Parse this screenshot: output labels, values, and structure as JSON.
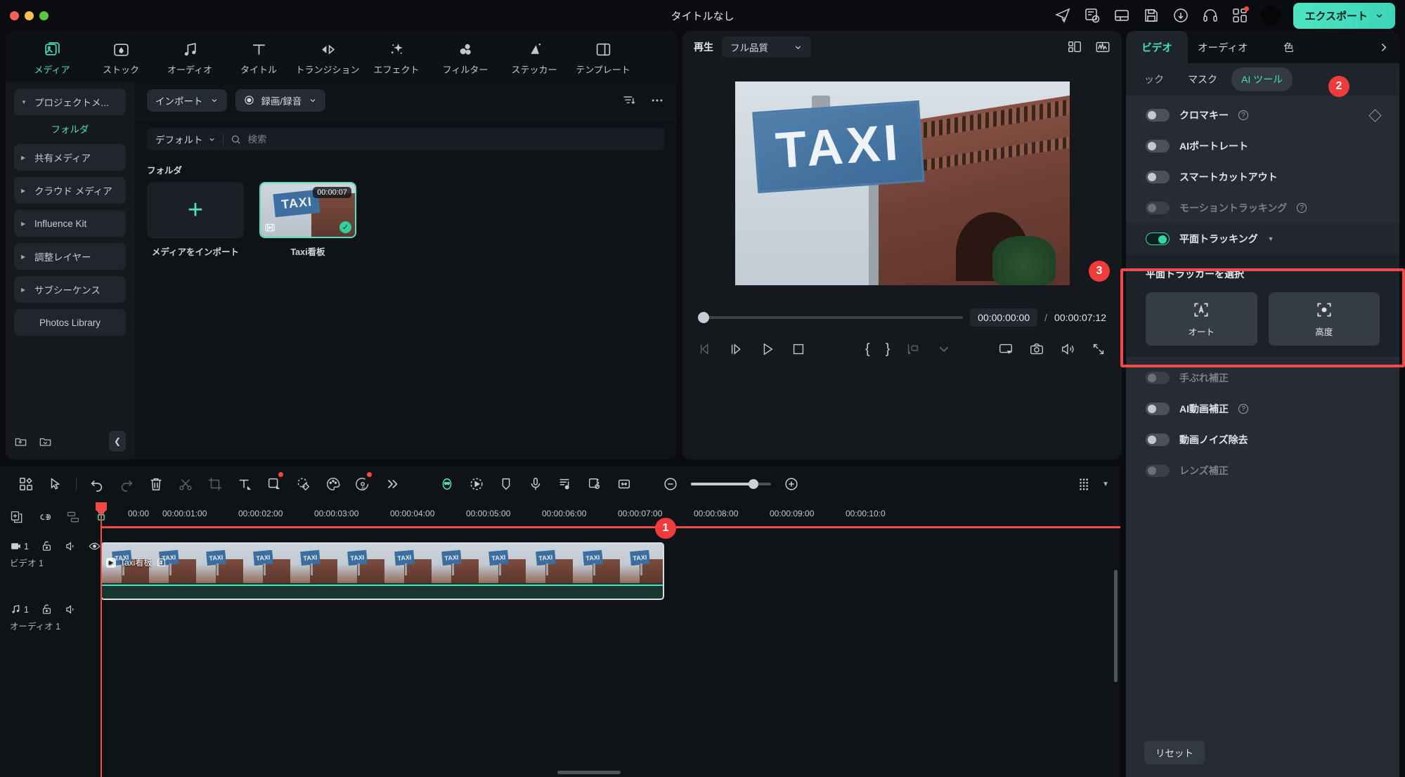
{
  "window": {
    "title": "タイトルなし"
  },
  "titlebar": {
    "icons": [
      "send-icon",
      "task-list-icon",
      "layout-icon",
      "save-icon",
      "cloud-upload-icon",
      "headset-support-icon",
      "apps-grid-icon"
    ],
    "avatar": "user-avatar",
    "export_label": "エクスポート"
  },
  "nav_tabs": [
    {
      "label": "メディア",
      "icon": "media-icon",
      "active": true
    },
    {
      "label": "ストック",
      "icon": "stock-icon",
      "active": false
    },
    {
      "label": "オーディオ",
      "icon": "audio-note-icon",
      "active": false
    },
    {
      "label": "タイトル",
      "icon": "title-text-icon",
      "active": false
    },
    {
      "label": "トランジション",
      "icon": "transition-icon",
      "active": false
    },
    {
      "label": "エフェクト",
      "icon": "effects-wand-icon",
      "active": false
    },
    {
      "label": "フィルター",
      "icon": "filter-circles-icon",
      "active": false
    },
    {
      "label": "ステッカー",
      "icon": "sticker-icon",
      "active": false
    },
    {
      "label": "テンプレート",
      "icon": "template-icon",
      "active": false
    }
  ],
  "media_sidebar": {
    "project_media": "プロジェクトメ...",
    "folder_heading": "フォルダ",
    "items": [
      {
        "label": "共有メディア"
      },
      {
        "label": "クラウド メディア"
      },
      {
        "label": "Influence Kit"
      },
      {
        "label": "調整レイヤー"
      },
      {
        "label": "サブシーケンス"
      }
    ],
    "photos_library": "Photos Library"
  },
  "media_toolbar": {
    "import_label": "インポート",
    "record_label": "録画/録音",
    "filter_icon": "filter-sort-icon",
    "more_icon": "more-horizontal-icon"
  },
  "media_search": {
    "sort_label": "デフォルト",
    "placeholder": "検索",
    "value": ""
  },
  "media_grid": {
    "folder_label": "フォルダ",
    "import_tile_label": "メディアをインポート",
    "items": [
      {
        "name": "Taxi看板",
        "duration": "00:00:07",
        "selected": true,
        "checked": true
      }
    ]
  },
  "preview": {
    "play_label": "再生",
    "quality_label": "フル品質",
    "grid_icon": "layout-grid-icon",
    "scope_icon": "waveform-scope-icon",
    "current_time": "00:00:00:00",
    "separator": "/",
    "total_time": "00:00:07:12",
    "controls": [
      "prev-frame-icon",
      "next-frame-icon",
      "play-icon",
      "stop-icon",
      "mark-in-icon",
      "mark-out-icon",
      "export-frame-icon",
      "chevron-down-icon",
      "screen-record-icon",
      "snapshot-icon",
      "volume-icon",
      "fullscreen-icon"
    ],
    "video_sign_text": "TAXI"
  },
  "right_panel": {
    "tabs": [
      {
        "label": "ビデオ",
        "active": true
      },
      {
        "label": "オーディオ",
        "active": false
      },
      {
        "label": "色",
        "active": false
      }
    ],
    "expand_icon": "chevron-right-icon",
    "subtabs": [
      {
        "label": "ック",
        "active": false,
        "clipped": true
      },
      {
        "label": "マスク",
        "active": false
      },
      {
        "label": "AI ツール",
        "active": true
      }
    ],
    "badge_subtab": "2",
    "rows": [
      {
        "label": "クロマキー",
        "on": false,
        "disabled": false,
        "help": true,
        "keyframe": true
      },
      {
        "label": "AIポートレート",
        "on": false,
        "disabled": false,
        "help": false,
        "keyframe": false
      },
      {
        "label": "スマートカットアウト",
        "on": false,
        "disabled": false,
        "help": false,
        "keyframe": false
      },
      {
        "label": "モーショントラッキング",
        "on": false,
        "disabled": true,
        "help": true,
        "keyframe": false
      }
    ],
    "planar": {
      "label": "平面トラッキング",
      "on": true,
      "select_title": "平面トラッカーを選択",
      "buttons": [
        {
          "label": "オート",
          "icon": "auto-tracker-icon"
        },
        {
          "label": "高度",
          "icon": "advanced-tracker-icon"
        }
      ],
      "badge": "3"
    },
    "rows_after": [
      {
        "label": "手ぶれ補正",
        "on": false,
        "disabled": true,
        "help": false
      },
      {
        "label": "AI動画補正",
        "on": false,
        "disabled": false,
        "help": true
      },
      {
        "label": "動画ノイズ除去",
        "on": false,
        "disabled": false,
        "help": false
      },
      {
        "label": "レンズ補正",
        "on": false,
        "disabled": true,
        "help": false
      }
    ],
    "reset_label": "リセット"
  },
  "timeline_toolbar": {
    "left_icons": [
      "template-grid-icon",
      "select-cursor-icon"
    ],
    "edit_icons": [
      "undo-icon",
      "redo-icon",
      "delete-icon",
      "split-scissors-icon",
      "crop-icon",
      "text-icon",
      "shape-icon",
      "mask-sticker-icon",
      "color-palette-icon",
      "ai-audio-icon",
      "more-chevrons-icon"
    ],
    "right_icons": [
      "green-screen-icon",
      "motion-icon",
      "marker-icon",
      "microphone-icon",
      "audio-detach-icon",
      "auto-reframe-icon",
      "fit-timeline-icon"
    ],
    "zoom_out_icon": "zoom-out-icon",
    "zoom_in_icon": "zoom-in-icon",
    "view_icon": "grid-view-icon"
  },
  "timeline": {
    "head_icons": [
      "duplicate-icon",
      "link-icon",
      "group-icon",
      "magnet-snap-icon"
    ],
    "ruler_ticks": [
      "00:00",
      "00:00:01:00",
      "00:00:02:00",
      "00:00:03:00",
      "00:00:04:00",
      "00:00:05:00",
      "00:00:06:00",
      "00:00:07:00",
      "00:00:08:00",
      "00:00:09:00",
      "00:00:10:0"
    ],
    "tracks": [
      {
        "kind": "video",
        "number": "1",
        "name": "ビデオ 1",
        "icons": [
          "video-track-icon",
          "lock-icon",
          "mute-icon",
          "eye-icon"
        ]
      },
      {
        "kind": "audio",
        "number": "1",
        "name": "オーディオ 1",
        "icons": [
          "audio-track-icon",
          "lock-icon",
          "mute-icon"
        ]
      }
    ],
    "clip": {
      "name": "Taxi看板",
      "badge": "1"
    }
  }
}
